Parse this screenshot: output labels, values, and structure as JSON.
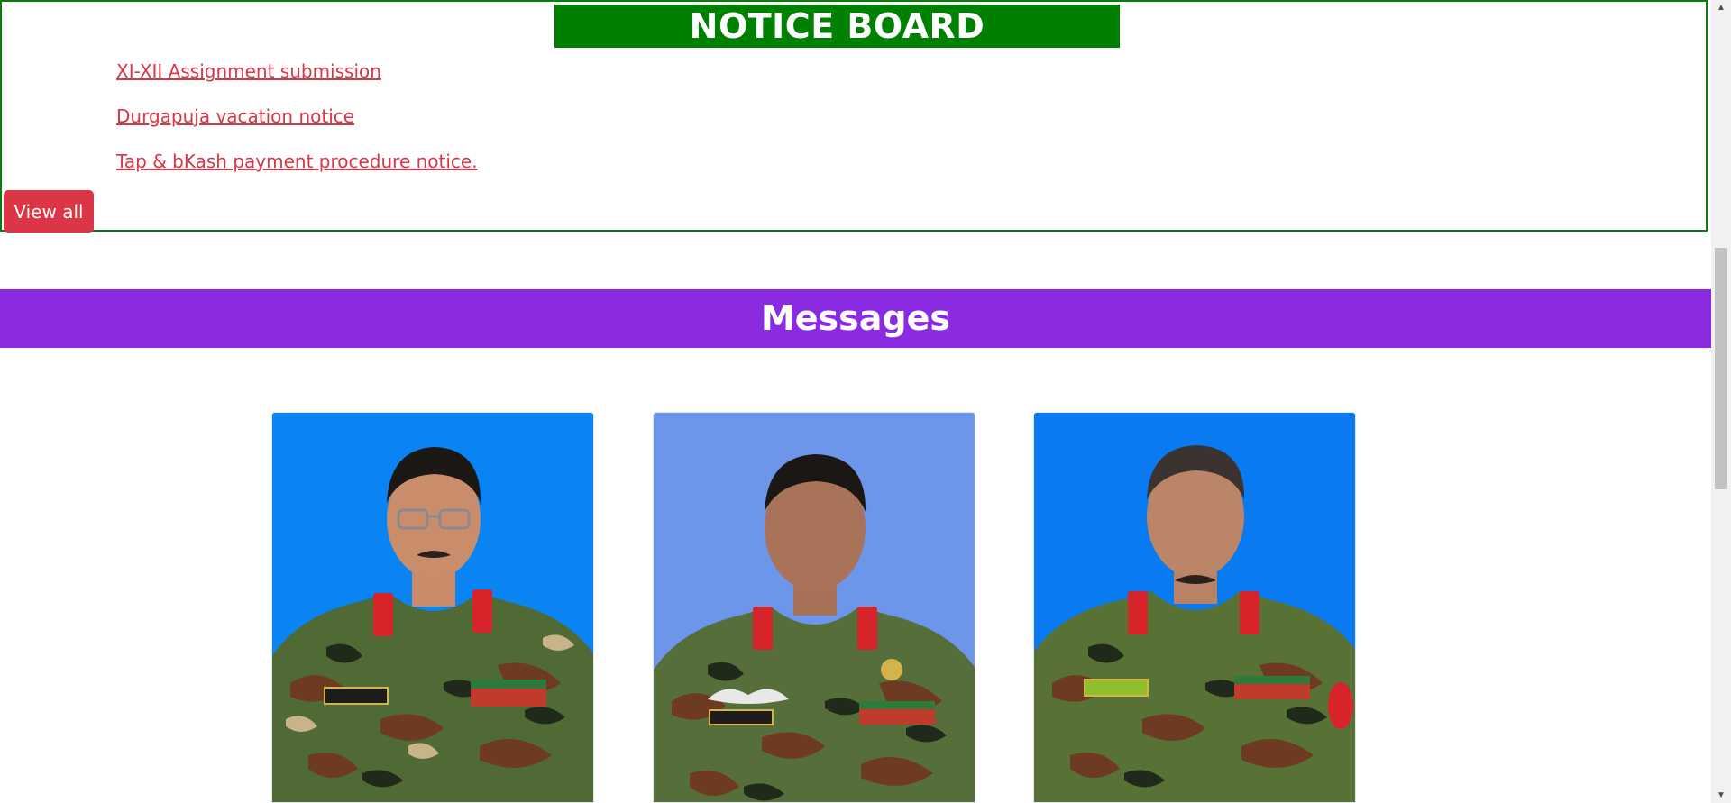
{
  "notice_board": {
    "title": "NOTICE BOARD",
    "notices": [
      {
        "label": "XI-XII Assignment submission"
      },
      {
        "label": "Durgapuja vacation notice"
      },
      {
        "label": "Tap & bKash payment procedure notice."
      }
    ],
    "view_all_label": "View all"
  },
  "messages": {
    "title": "Messages",
    "cards": [
      {
        "photo_bg": "#0a84f2"
      },
      {
        "photo_bg": "#6d96ea"
      },
      {
        "photo_bg": "#0a7af0"
      }
    ]
  },
  "scrollbar": {
    "up_glyph": "▲",
    "down_glyph": "▼"
  },
  "colors": {
    "notice_title_bg": "#008000",
    "notice_border": "#0d7a0d",
    "link": "#dc3545",
    "button_bg": "#dc3545",
    "messages_banner_bg": "#8a2be2"
  }
}
